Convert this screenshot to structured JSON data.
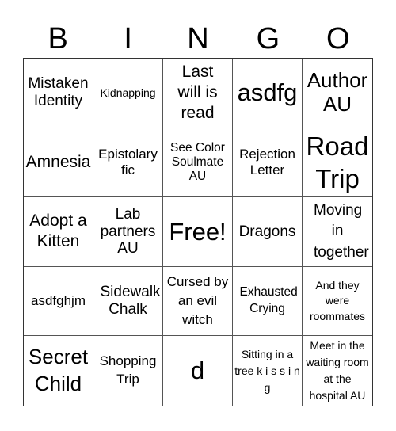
{
  "header": [
    "B",
    "I",
    "N",
    "G",
    "O"
  ],
  "cells": [
    "Mistaken Identity",
    "Kidnapping",
    "Last will is read",
    "asdfg",
    "Author AU",
    "Amnesia",
    "Epistolary fic",
    "See Color Soulmate AU",
    "Rejection Letter",
    "Road Trip",
    "Adopt a Kitten",
    "Lab partners AU",
    "Free!",
    "Dragons",
    "Moving in together",
    "asdfghjm",
    "Sidewalk Chalk",
    "Cursed by an evil witch",
    "Exhausted Crying",
    "And they were roommates",
    "Secret Child",
    "Shopping Trip",
    "d",
    "Sitting in a tree k i s s i n g",
    "Meet in the waiting room at the hospital AU"
  ]
}
